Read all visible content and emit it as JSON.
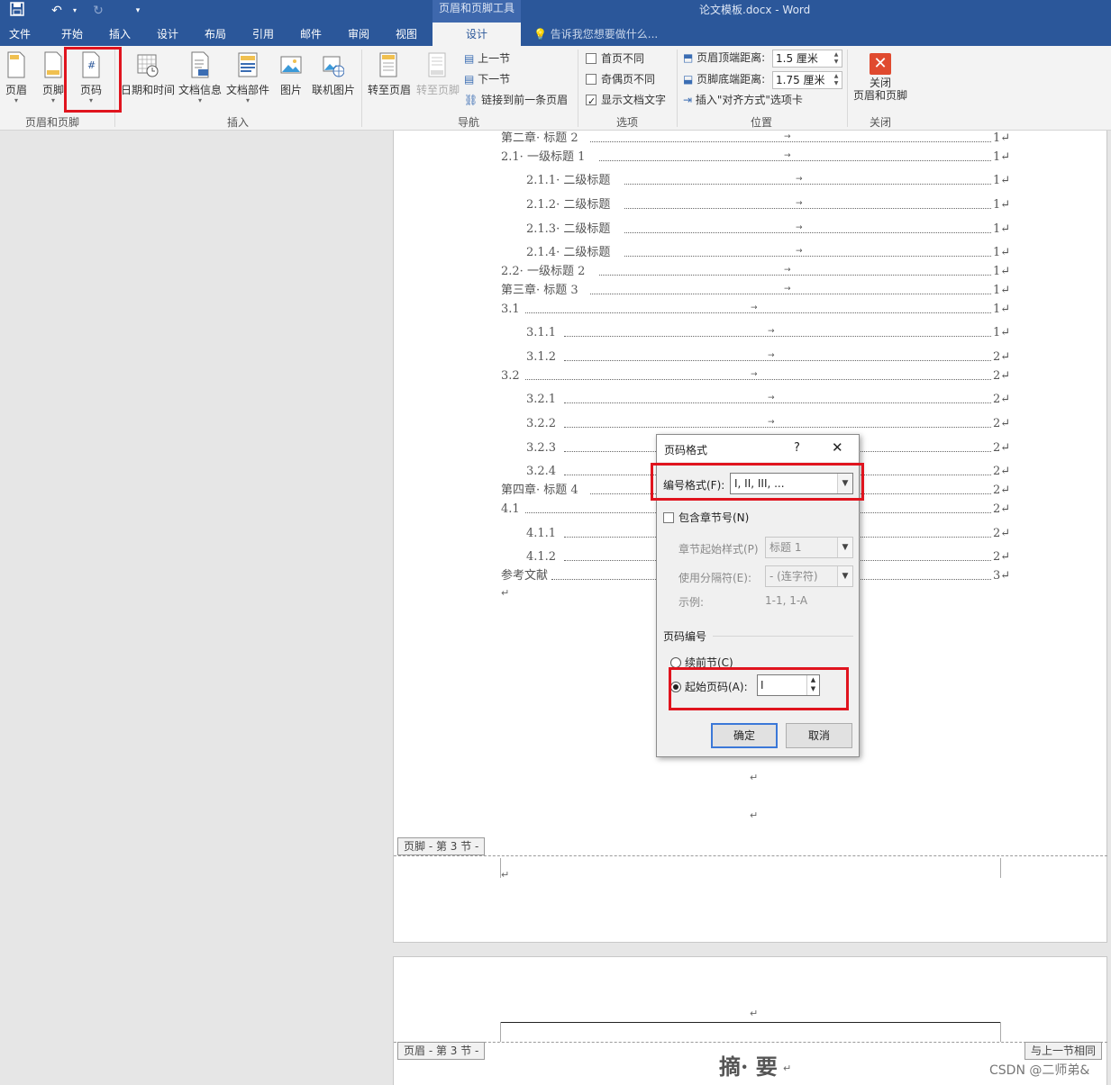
{
  "titlebar": {
    "save_icon": "save-icon",
    "undo_icon": "undo-icon",
    "redo_icon": "redo-icon",
    "customize_icon": "customize-icon",
    "context_tool": "页眉和页脚工具",
    "document_title": "论文模板.docx - Word"
  },
  "tabs": {
    "file": "文件",
    "home": "开始",
    "insert": "插入",
    "design": "设计",
    "layout": "布局",
    "references": "引用",
    "mailings": "邮件",
    "review": "审阅",
    "view": "视图",
    "hf_design": "设计",
    "tell_me": "告诉我您想要做什么..."
  },
  "ribbon": {
    "header": "页眉",
    "footer": "页脚",
    "page_number": "页码",
    "group_hf": "页眉和页脚",
    "date_time": "日期和时间",
    "doc_info": "文档信息",
    "quick_parts": "文档部件",
    "picture": "图片",
    "online_picture": "联机图片",
    "group_insert": "插入",
    "goto_header": "转至页眉",
    "goto_footer": "转至页脚",
    "previous": "上一节",
    "next": "下一节",
    "link_previous": "链接到前一条页眉",
    "group_nav": "导航",
    "different_first": "首页不同",
    "different_odd_even": "奇偶页不同",
    "show_doc_text": "显示文档文字",
    "group_options": "选项",
    "header_from_top": "页眉顶端距离:",
    "header_from_top_value": "1.5 厘米",
    "footer_from_bottom": "页脚底端距离:",
    "footer_from_bottom_value": "1.75 厘米",
    "insert_align_tab": "插入\"对齐方式\"选项卡",
    "group_position": "位置",
    "close_line1": "关闭",
    "close_line2": "页眉和页脚",
    "group_close": "关闭",
    "different_first_checked": false,
    "different_odd_even_checked": false,
    "show_doc_text_checked": true
  },
  "toc": [
    {
      "text": "第二章· 标题 2",
      "page": "1"
    },
    {
      "text": "2.1· 一级标题 1",
      "page": "1"
    },
    {
      "text": "2.1.1· 二级标题",
      "page": "1"
    },
    {
      "text": "2.1.2· 二级标题",
      "page": "1"
    },
    {
      "text": "2.1.3· 二级标题",
      "page": "1"
    },
    {
      "text": "2.1.4· 二级标题",
      "page": "1"
    },
    {
      "text": "2.2· 一级标题 2",
      "page": "1"
    },
    {
      "text": "第三章· 标题 3",
      "page": "1"
    },
    {
      "text": "3.1",
      "page": "1"
    },
    {
      "text": "3.1.1",
      "page": "1"
    },
    {
      "text": "3.1.2",
      "page": "2"
    },
    {
      "text": "3.2",
      "page": "2"
    },
    {
      "text": "3.2.1",
      "page": "2"
    },
    {
      "text": "3.2.2",
      "page": "2"
    },
    {
      "text": "3.2.3",
      "page": "2"
    },
    {
      "text": "3.2.4",
      "page": "2"
    },
    {
      "text": "第四章· 标题 4",
      "page": "2"
    },
    {
      "text": "4.1",
      "page": "2"
    },
    {
      "text": "4.1.1",
      "page": "2"
    },
    {
      "text": "4.1.2",
      "page": "2"
    },
    {
      "text": "参考文献",
      "page": "3"
    }
  ],
  "marks": {
    "paragraph": "↵",
    "tab_arrow": "→"
  },
  "footer_label": "页脚 - 第 3 节 -",
  "header_label": "页眉 - 第 3 节 -",
  "same_as_previous": "与上一节相同",
  "abstract_title": "摘· 要",
  "dialog": {
    "title": "页码格式",
    "help": "?",
    "close": "✕",
    "number_format_label": "编号格式(F):",
    "number_format_value": "I, II, III, ...",
    "include_chapter": "包含章节号(N)",
    "chapter_style_label": "章节起始样式(P)",
    "chapter_style_value": "标题 1",
    "separator_label": "使用分隔符(E):",
    "separator_value": "-  (连字符)",
    "example_label": "示例:",
    "example_value": "1-1, 1-A",
    "section_title": "页码编号",
    "continue_label": "续前节(C)",
    "start_at_label": "起始页码(A):",
    "start_at_value": "I",
    "ok": "确定",
    "cancel": "取消"
  },
  "watermark": "CSDN @二师弟&"
}
